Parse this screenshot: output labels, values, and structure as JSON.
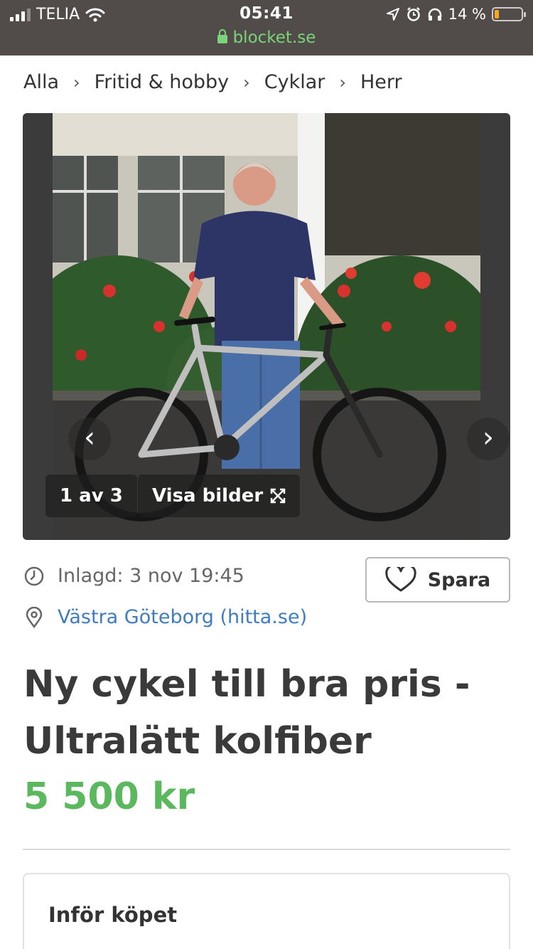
{
  "status_bar": {
    "carrier": "TELIA",
    "time": "05:41",
    "battery": "14 %",
    "battery_level": 0.14,
    "url": "blocket.se"
  },
  "breadcrumb": [
    "Alla",
    "Fritid & hobby",
    "Cyklar",
    "Herr"
  ],
  "gallery": {
    "counter": "1 av 3",
    "show_images": "Visa bilder"
  },
  "ad": {
    "posted": "Inlagd: 3 nov 19:45",
    "location": "Västra Göteborg (hitta.se)",
    "save_label": "Spara",
    "title": "Ny cykel till bra pris - Ult­ralätt kolfiber",
    "price": "5 500 kr"
  },
  "purchase_card": {
    "title": "Inför köpet"
  },
  "colors": {
    "price_green": "#5cb85f",
    "link_blue": "#3f7cc1",
    "url_green": "#7bd37a"
  }
}
